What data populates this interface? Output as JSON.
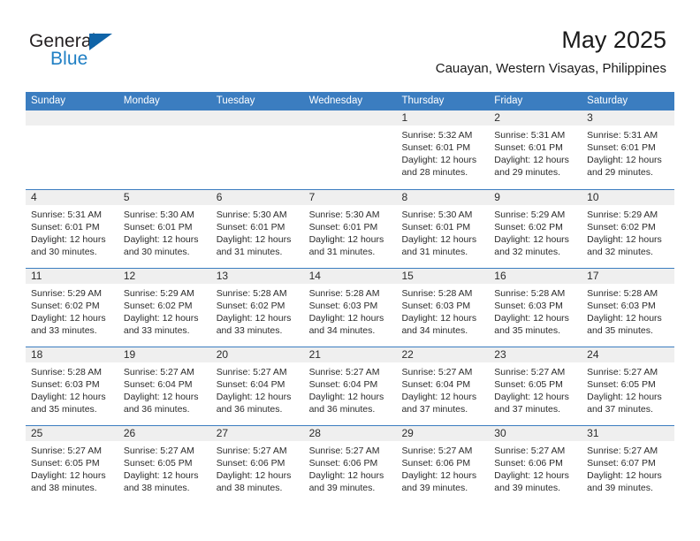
{
  "brand": {
    "name_part1": "General",
    "name_part2": "Blue",
    "triangle_color": "#1064a8",
    "blue_text_color": "#1f7fc4"
  },
  "header": {
    "title": "May 2025",
    "location": "Cauayan, Western Visayas, Philippines"
  },
  "theme": {
    "header_blue": "#3b7dc0",
    "day_head_gray": "#efefef",
    "text": "#2b2b2b"
  },
  "weekdays": [
    "Sunday",
    "Monday",
    "Tuesday",
    "Wednesday",
    "Thursday",
    "Friday",
    "Saturday"
  ],
  "labels": {
    "sunrise": "Sunrise:",
    "sunset": "Sunset:",
    "daylight": "Daylight:"
  },
  "weeks": [
    [
      {
        "day": "",
        "empty": true
      },
      {
        "day": "",
        "empty": true
      },
      {
        "day": "",
        "empty": true
      },
      {
        "day": "",
        "empty": true
      },
      {
        "day": "1",
        "sunrise": "Sunrise: 5:32 AM",
        "sunset": "Sunset: 6:01 PM",
        "daylight_l1": "Daylight: 12 hours",
        "daylight_l2": "and 28 minutes."
      },
      {
        "day": "2",
        "sunrise": "Sunrise: 5:31 AM",
        "sunset": "Sunset: 6:01 PM",
        "daylight_l1": "Daylight: 12 hours",
        "daylight_l2": "and 29 minutes."
      },
      {
        "day": "3",
        "sunrise": "Sunrise: 5:31 AM",
        "sunset": "Sunset: 6:01 PM",
        "daylight_l1": "Daylight: 12 hours",
        "daylight_l2": "and 29 minutes."
      }
    ],
    [
      {
        "day": "4",
        "sunrise": "Sunrise: 5:31 AM",
        "sunset": "Sunset: 6:01 PM",
        "daylight_l1": "Daylight: 12 hours",
        "daylight_l2": "and 30 minutes."
      },
      {
        "day": "5",
        "sunrise": "Sunrise: 5:30 AM",
        "sunset": "Sunset: 6:01 PM",
        "daylight_l1": "Daylight: 12 hours",
        "daylight_l2": "and 30 minutes."
      },
      {
        "day": "6",
        "sunrise": "Sunrise: 5:30 AM",
        "sunset": "Sunset: 6:01 PM",
        "daylight_l1": "Daylight: 12 hours",
        "daylight_l2": "and 31 minutes."
      },
      {
        "day": "7",
        "sunrise": "Sunrise: 5:30 AM",
        "sunset": "Sunset: 6:01 PM",
        "daylight_l1": "Daylight: 12 hours",
        "daylight_l2": "and 31 minutes."
      },
      {
        "day": "8",
        "sunrise": "Sunrise: 5:30 AM",
        "sunset": "Sunset: 6:01 PM",
        "daylight_l1": "Daylight: 12 hours",
        "daylight_l2": "and 31 minutes."
      },
      {
        "day": "9",
        "sunrise": "Sunrise: 5:29 AM",
        "sunset": "Sunset: 6:02 PM",
        "daylight_l1": "Daylight: 12 hours",
        "daylight_l2": "and 32 minutes."
      },
      {
        "day": "10",
        "sunrise": "Sunrise: 5:29 AM",
        "sunset": "Sunset: 6:02 PM",
        "daylight_l1": "Daylight: 12 hours",
        "daylight_l2": "and 32 minutes."
      }
    ],
    [
      {
        "day": "11",
        "sunrise": "Sunrise: 5:29 AM",
        "sunset": "Sunset: 6:02 PM",
        "daylight_l1": "Daylight: 12 hours",
        "daylight_l2": "and 33 minutes."
      },
      {
        "day": "12",
        "sunrise": "Sunrise: 5:29 AM",
        "sunset": "Sunset: 6:02 PM",
        "daylight_l1": "Daylight: 12 hours",
        "daylight_l2": "and 33 minutes."
      },
      {
        "day": "13",
        "sunrise": "Sunrise: 5:28 AM",
        "sunset": "Sunset: 6:02 PM",
        "daylight_l1": "Daylight: 12 hours",
        "daylight_l2": "and 33 minutes."
      },
      {
        "day": "14",
        "sunrise": "Sunrise: 5:28 AM",
        "sunset": "Sunset: 6:03 PM",
        "daylight_l1": "Daylight: 12 hours",
        "daylight_l2": "and 34 minutes."
      },
      {
        "day": "15",
        "sunrise": "Sunrise: 5:28 AM",
        "sunset": "Sunset: 6:03 PM",
        "daylight_l1": "Daylight: 12 hours",
        "daylight_l2": "and 34 minutes."
      },
      {
        "day": "16",
        "sunrise": "Sunrise: 5:28 AM",
        "sunset": "Sunset: 6:03 PM",
        "daylight_l1": "Daylight: 12 hours",
        "daylight_l2": "and 35 minutes."
      },
      {
        "day": "17",
        "sunrise": "Sunrise: 5:28 AM",
        "sunset": "Sunset: 6:03 PM",
        "daylight_l1": "Daylight: 12 hours",
        "daylight_l2": "and 35 minutes."
      }
    ],
    [
      {
        "day": "18",
        "sunrise": "Sunrise: 5:28 AM",
        "sunset": "Sunset: 6:03 PM",
        "daylight_l1": "Daylight: 12 hours",
        "daylight_l2": "and 35 minutes."
      },
      {
        "day": "19",
        "sunrise": "Sunrise: 5:27 AM",
        "sunset": "Sunset: 6:04 PM",
        "daylight_l1": "Daylight: 12 hours",
        "daylight_l2": "and 36 minutes."
      },
      {
        "day": "20",
        "sunrise": "Sunrise: 5:27 AM",
        "sunset": "Sunset: 6:04 PM",
        "daylight_l1": "Daylight: 12 hours",
        "daylight_l2": "and 36 minutes."
      },
      {
        "day": "21",
        "sunrise": "Sunrise: 5:27 AM",
        "sunset": "Sunset: 6:04 PM",
        "daylight_l1": "Daylight: 12 hours",
        "daylight_l2": "and 36 minutes."
      },
      {
        "day": "22",
        "sunrise": "Sunrise: 5:27 AM",
        "sunset": "Sunset: 6:04 PM",
        "daylight_l1": "Daylight: 12 hours",
        "daylight_l2": "and 37 minutes."
      },
      {
        "day": "23",
        "sunrise": "Sunrise: 5:27 AM",
        "sunset": "Sunset: 6:05 PM",
        "daylight_l1": "Daylight: 12 hours",
        "daylight_l2": "and 37 minutes."
      },
      {
        "day": "24",
        "sunrise": "Sunrise: 5:27 AM",
        "sunset": "Sunset: 6:05 PM",
        "daylight_l1": "Daylight: 12 hours",
        "daylight_l2": "and 37 minutes."
      }
    ],
    [
      {
        "day": "25",
        "sunrise": "Sunrise: 5:27 AM",
        "sunset": "Sunset: 6:05 PM",
        "daylight_l1": "Daylight: 12 hours",
        "daylight_l2": "and 38 minutes."
      },
      {
        "day": "26",
        "sunrise": "Sunrise: 5:27 AM",
        "sunset": "Sunset: 6:05 PM",
        "daylight_l1": "Daylight: 12 hours",
        "daylight_l2": "and 38 minutes."
      },
      {
        "day": "27",
        "sunrise": "Sunrise: 5:27 AM",
        "sunset": "Sunset: 6:06 PM",
        "daylight_l1": "Daylight: 12 hours",
        "daylight_l2": "and 38 minutes."
      },
      {
        "day": "28",
        "sunrise": "Sunrise: 5:27 AM",
        "sunset": "Sunset: 6:06 PM",
        "daylight_l1": "Daylight: 12 hours",
        "daylight_l2": "and 39 minutes."
      },
      {
        "day": "29",
        "sunrise": "Sunrise: 5:27 AM",
        "sunset": "Sunset: 6:06 PM",
        "daylight_l1": "Daylight: 12 hours",
        "daylight_l2": "and 39 minutes."
      },
      {
        "day": "30",
        "sunrise": "Sunrise: 5:27 AM",
        "sunset": "Sunset: 6:06 PM",
        "daylight_l1": "Daylight: 12 hours",
        "daylight_l2": "and 39 minutes."
      },
      {
        "day": "31",
        "sunrise": "Sunrise: 5:27 AM",
        "sunset": "Sunset: 6:07 PM",
        "daylight_l1": "Daylight: 12 hours",
        "daylight_l2": "and 39 minutes."
      }
    ]
  ]
}
